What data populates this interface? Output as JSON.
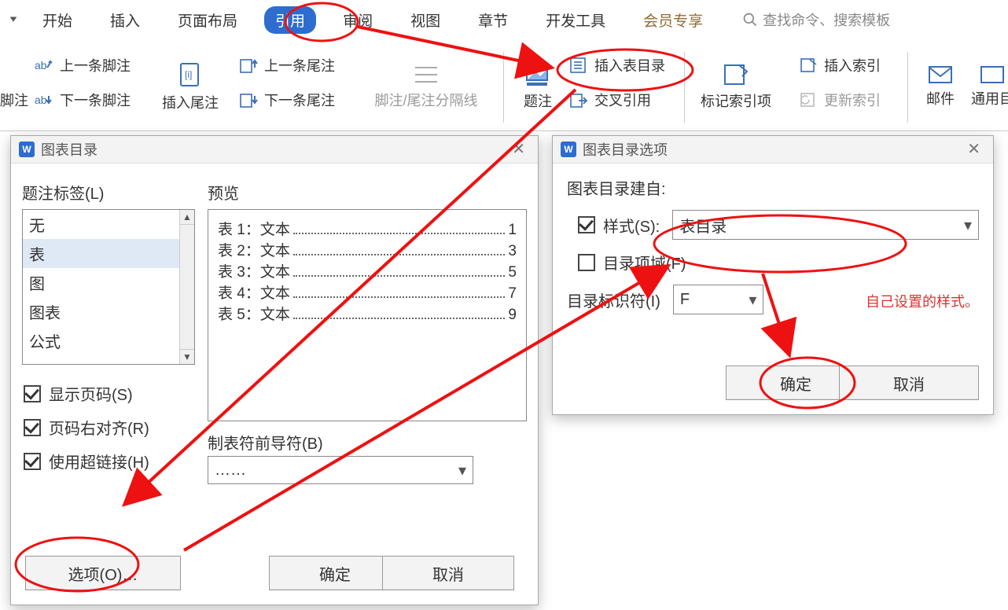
{
  "menu": {
    "items": [
      "开始",
      "插入",
      "页面布局",
      "引用",
      "审阅",
      "视图",
      "章节",
      "开发工具",
      "会员专享"
    ],
    "active_index": 3,
    "search_placeholder": "查找命令、搜索模板"
  },
  "ribbon": {
    "prev_footnote": "上一条脚注",
    "next_footnote": "下一条脚注",
    "insert_endnote": "插入尾注",
    "prev_endnote": "上一条尾注",
    "next_endnote": "下一条尾注",
    "separator": "脚注/尾注分隔线",
    "caption": "题注",
    "insert_table_of_figures": "插入表目录",
    "cross_reference": "交叉引用",
    "mark_index": "标记索引项",
    "insert_index": "插入索引",
    "update_index": "更新索引",
    "mail": "邮件",
    "general": "通用目",
    "footnote_tail": "脚注"
  },
  "dlg1": {
    "title": "图表目录",
    "label_caption": "题注标签(L)",
    "label_preview": "预览",
    "list": [
      "无",
      "表",
      "图",
      "图表",
      "公式"
    ],
    "selected_index": 1,
    "preview_rows": [
      {
        "label": "表 1：文本",
        "page": "1"
      },
      {
        "label": "表 2：文本",
        "page": "3"
      },
      {
        "label": "表 3：文本",
        "page": "5"
      },
      {
        "label": "表 4：文本",
        "page": "7"
      },
      {
        "label": "表 5：文本",
        "page": "9"
      }
    ],
    "checks": {
      "show_page": "显示页码(S)",
      "right_align": "页码右对齐(R)",
      "use_link": "使用超链接(H)"
    },
    "leader_label": "制表符前导符(B)",
    "leader_value": "……",
    "btn_options": "选项(O)…",
    "btn_ok": "确定",
    "btn_cancel": "取消"
  },
  "dlg2": {
    "title": "图表目录选项",
    "build_from": "图表目录建自:",
    "chk_style": "样式(S):",
    "chk_entry": "目录项域(F)",
    "style_value": "表目录",
    "id_label": "目录标识符(I)",
    "id_value": "F",
    "annot": "自己设置的样式。",
    "btn_ok": "确定",
    "btn_cancel": "取消"
  }
}
